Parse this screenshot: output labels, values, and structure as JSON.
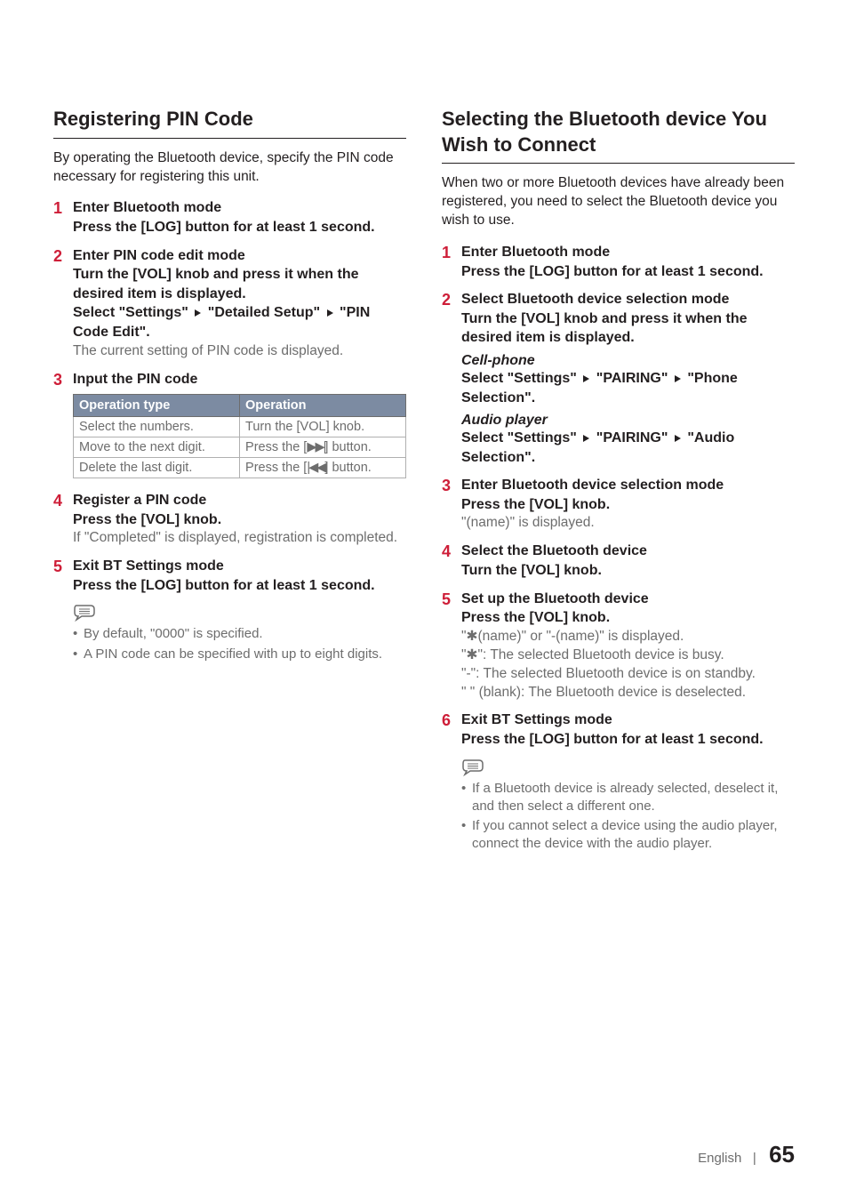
{
  "left": {
    "title": "Registering PIN Code",
    "intro": "By operating the Bluetooth device, specify the PIN code necessary for registering this unit.",
    "steps": [
      {
        "num": "1",
        "title": "Enter Bluetooth mode",
        "instr": "Press the [LOG] button for at least 1 second."
      },
      {
        "num": "2",
        "title": "Enter PIN code edit mode",
        "instr": "Turn the [VOL] knob and press it when the desired item is displayed.",
        "select_pre": "Select \"Settings\"",
        "select_mid": "\"Detailed Setup\"",
        "select_post": "\"PIN Code Edit\".",
        "note": "The current setting of PIN code is displayed."
      },
      {
        "num": "3",
        "title": "Input the PIN code",
        "table": {
          "h1": "Operation type",
          "h2": "Operation",
          "rows": [
            {
              "c1": "Select the numbers.",
              "c2": "Turn the [VOL] knob."
            },
            {
              "c1": "Move to the next digit.",
              "c2_pre": "Press the [",
              "c2_icon": "next-track",
              "c2_post": "] button."
            },
            {
              "c1": "Delete the last digit.",
              "c2_pre": "Press the [",
              "c2_icon": "prev-track",
              "c2_post": "] button."
            }
          ]
        }
      },
      {
        "num": "4",
        "title": "Register a PIN code",
        "instr": "Press the [VOL] knob.",
        "note": "If \"Completed\" is displayed, registration is completed."
      },
      {
        "num": "5",
        "title": "Exit BT Settings mode",
        "instr": "Press the [LOG] button for at least 1 second."
      }
    ],
    "notes": [
      "By default, \"0000\" is specified.",
      "A PIN code can be specified with up to eight digits."
    ]
  },
  "right": {
    "title": "Selecting the Bluetooth device You Wish to Connect",
    "intro": "When two or more Bluetooth devices have already been registered, you need to select the Bluetooth device you wish to use.",
    "steps": [
      {
        "num": "1",
        "title": "Enter Bluetooth mode",
        "instr": "Press the [LOG] button for at least 1 second."
      },
      {
        "num": "2",
        "title": "Select Bluetooth device selection mode",
        "instr": "Turn the [VOL] knob and press it when the desired item is displayed.",
        "sub1_head": "Cell-phone",
        "sub1_pre": "Select \"Settings\"",
        "sub1_mid": "\"PAIRING\"",
        "sub1_post": "\"Phone Selection\".",
        "sub2_head": "Audio player",
        "sub2_pre": "Select \"Settings\"",
        "sub2_mid": "\"PAIRING\"",
        "sub2_post": "\"Audio Selection\"."
      },
      {
        "num": "3",
        "title": "Enter Bluetooth device selection mode",
        "instr": "Press the [VOL] knob.",
        "note": "\"(name)\" is displayed."
      },
      {
        "num": "4",
        "title": "Select the Bluetooth device",
        "instr": "Turn the [VOL] knob."
      },
      {
        "num": "5",
        "title": "Set up the Bluetooth device",
        "instr": "Press the [VOL] knob.",
        "results": [
          "\"✱(name)\" or \"-(name)\" is displayed.",
          "\"✱\": The selected Bluetooth device is busy.",
          "\"-\": The selected Bluetooth device is on standby.",
          "\" \" (blank): The Bluetooth device is deselected."
        ]
      },
      {
        "num": "6",
        "title": "Exit BT Settings mode",
        "instr": "Press the [LOG] button for at least 1 second."
      }
    ],
    "notes": [
      "If a Bluetooth device is already selected, deselect it, and then select a different one.",
      "If you cannot select a device using the audio player, connect the device with the audio player."
    ]
  },
  "footer": {
    "lang": "English",
    "sep": "|",
    "page": "65"
  }
}
